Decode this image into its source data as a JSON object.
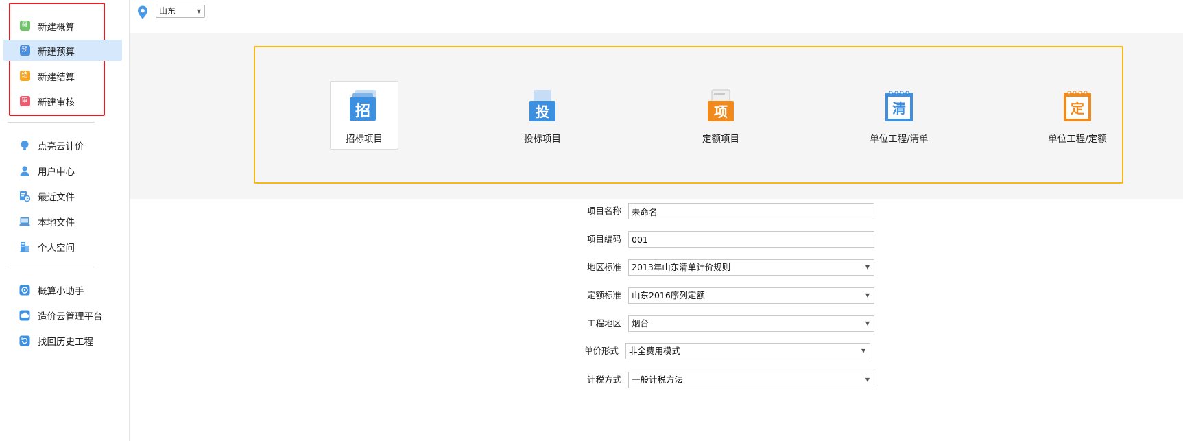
{
  "sidebar": {
    "create_items": [
      {
        "label": "新建概算",
        "icon_text": "概",
        "color": "#6fc36b",
        "active": false
      },
      {
        "label": "新建预算",
        "icon_text": "预",
        "color": "#4a90e2",
        "active": true
      },
      {
        "label": "新建结算",
        "icon_text": "结",
        "color": "#f5a623",
        "active": false
      },
      {
        "label": "新建审核",
        "icon_text": "审",
        "color": "#ee5a6f",
        "active": false
      }
    ],
    "account_items": [
      {
        "label": "点亮云计价",
        "icon": "bulb-icon"
      },
      {
        "label": "用户中心",
        "icon": "user-icon"
      },
      {
        "label": "最近文件",
        "icon": "recent-files-icon"
      },
      {
        "label": "本地文件",
        "icon": "local-files-icon"
      },
      {
        "label": "个人空间",
        "icon": "personal-space-icon"
      }
    ],
    "tool_items": [
      {
        "label": "概算小助手",
        "icon": "assistant-icon"
      },
      {
        "label": "造价云管理平台",
        "icon": "cloud-platform-icon"
      },
      {
        "label": "找回历史工程",
        "icon": "history-icon"
      }
    ]
  },
  "topbar": {
    "region": "山东",
    "location_icon": "location-pin-icon"
  },
  "project_types": [
    {
      "label": "招标项目",
      "glyph": "招",
      "color": "#3d8fe0",
      "selected": true
    },
    {
      "label": "投标项目",
      "glyph": "投",
      "color": "#3d8fe0",
      "selected": false
    },
    {
      "label": "定额项目",
      "glyph": "项",
      "color": "#f08a1c",
      "selected": false
    },
    {
      "label": "单位工程/清单",
      "glyph": "清",
      "color": "#3d8fe0",
      "selected": false
    },
    {
      "label": "单位工程/定额",
      "glyph": "定",
      "color": "#f08a1c",
      "selected": false
    }
  ],
  "form": {
    "project_name": {
      "label": "项目名称",
      "value": "未命名"
    },
    "project_code": {
      "label": "项目编码",
      "value": "001"
    },
    "region_standard": {
      "label": "地区标准",
      "value": "2013年山东清单计价规则"
    },
    "quota_standard": {
      "label": "定额标准",
      "value": "山东2016序列定额"
    },
    "project_area": {
      "label": "工程地区",
      "value": "烟台"
    },
    "unit_price_form": {
      "label": "单价形式",
      "value": "非全费用模式"
    },
    "tax_method": {
      "label": "计税方式",
      "value": "一般计税方法"
    }
  },
  "colors": {
    "accent_blue": "#4a90e2",
    "panel_border": "#f8b816",
    "highlight_border": "#e02020",
    "active_bg": "#d6e8fb"
  }
}
